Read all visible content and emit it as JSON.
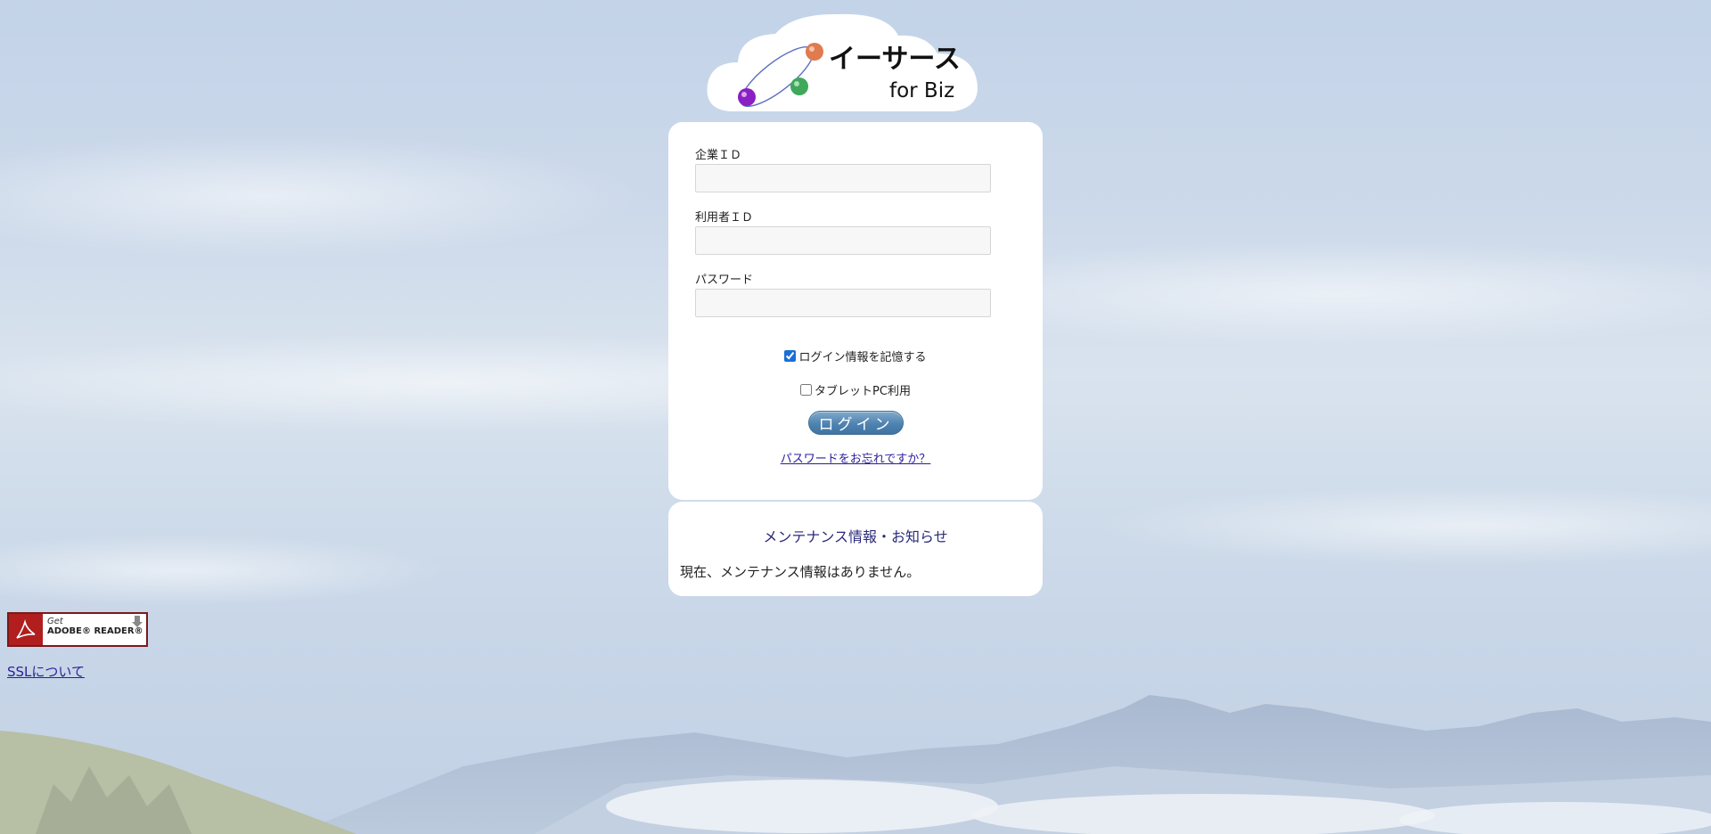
{
  "logo": {
    "title": "イーサース",
    "subtitle": "for Biz"
  },
  "login_form": {
    "company_id_label": "企業ＩＤ",
    "company_id_value": "",
    "user_id_label": "利用者ＩＤ",
    "user_id_value": "",
    "password_label": "パスワード",
    "password_value": "",
    "remember_label": "ログイン情報を記憶する",
    "remember_checked": true,
    "tablet_label": "タブレットPC利用",
    "tablet_checked": false,
    "login_button": "ログイン",
    "forgot_link": "パスワードをお忘れですか？"
  },
  "info": {
    "title": "メンテナンス情報・お知らせ",
    "message": "現在、メンテナンス情報はありません。"
  },
  "adobe": {
    "get": "Get",
    "reader": "ADOBE® READER®"
  },
  "footer": {
    "ssl_link": "SSLについて"
  },
  "colors": {
    "panel": "#ffffff",
    "button": "#4f83b0",
    "link": "#2a1f9c",
    "adobe_red": "#b01e1e"
  },
  "icons": [
    "cloud-logo-icon",
    "orbit-icon",
    "checkbox-icon",
    "acrobat-icon",
    "download-arrow-icon"
  ]
}
